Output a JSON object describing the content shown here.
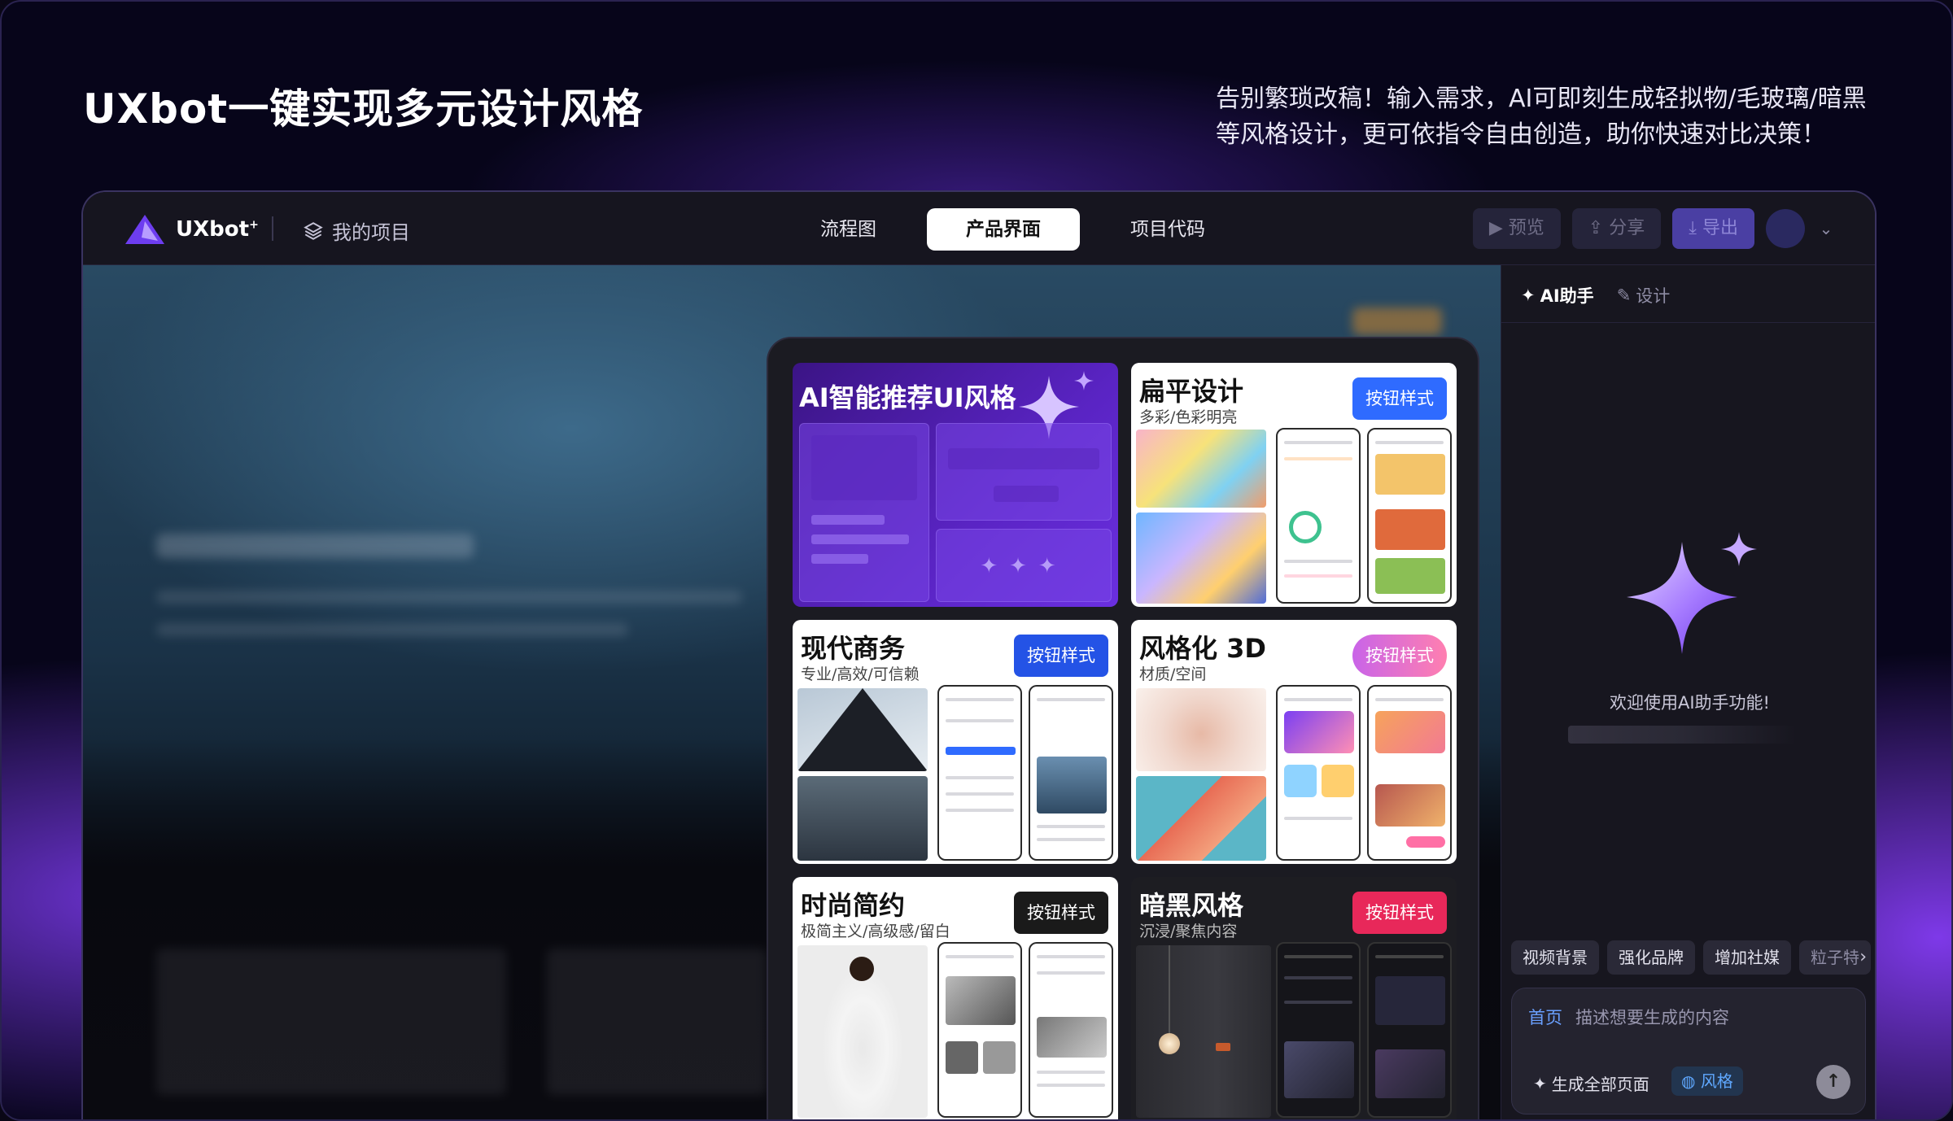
{
  "hero": {
    "title": "UXbot一键实现多元设计风格",
    "desc_line1": "告别繁琐改稿！输入需求，AI可即刻生成轻拟物/毛玻璃/暗黑",
    "desc_line2": "等风格设计，更可依指令自由创造，助你快速对比决策！"
  },
  "topbar": {
    "logo": "UXbot",
    "logo_sup": "+",
    "my_project": "我的项目",
    "tabs": [
      "流程图",
      "产品界面",
      "项目代码"
    ],
    "active_tab": "产品界面",
    "preview": "预览",
    "share": "分享",
    "export": "导出"
  },
  "styles": {
    "ai_card_title": "AI智能推荐UI风格",
    "cards": [
      {
        "title": "扁平设计",
        "sub": "多彩/色彩明亮",
        "btn": "按钮样式",
        "btn_color": "#2f6bff"
      },
      {
        "title": "现代商务",
        "sub": "专业/高效/可信赖",
        "btn": "按钮样式",
        "btn_color": "#2453e6"
      },
      {
        "title": "风格化 3D",
        "sub": "材质/空间",
        "btn": "按钮样式",
        "btn_color": "#d15bd8"
      },
      {
        "title": "时尚简约",
        "sub": "极简主义/高级感/留白",
        "btn": "按钮样式",
        "btn_color": "#1a1a1a"
      },
      {
        "title": "暗黑风格",
        "sub": "沉浸/聚焦内容",
        "btn": "按钮样式",
        "btn_color": "#e8285a"
      }
    ]
  },
  "ai": {
    "tab_assistant": "AI助手",
    "tab_design": "设计",
    "welcome": "欢迎使用AI助手功能!",
    "chips": [
      "视频背景",
      "强化品牌",
      "增加社媒",
      "粒子特"
    ],
    "composer_tag": "首页",
    "composer_placeholder": "描述想要生成的内容",
    "generate_all": "生成全部页面",
    "style_btn": "风格"
  },
  "colors": {
    "accent": "#7c3aed",
    "page_bg": "#07051a"
  }
}
